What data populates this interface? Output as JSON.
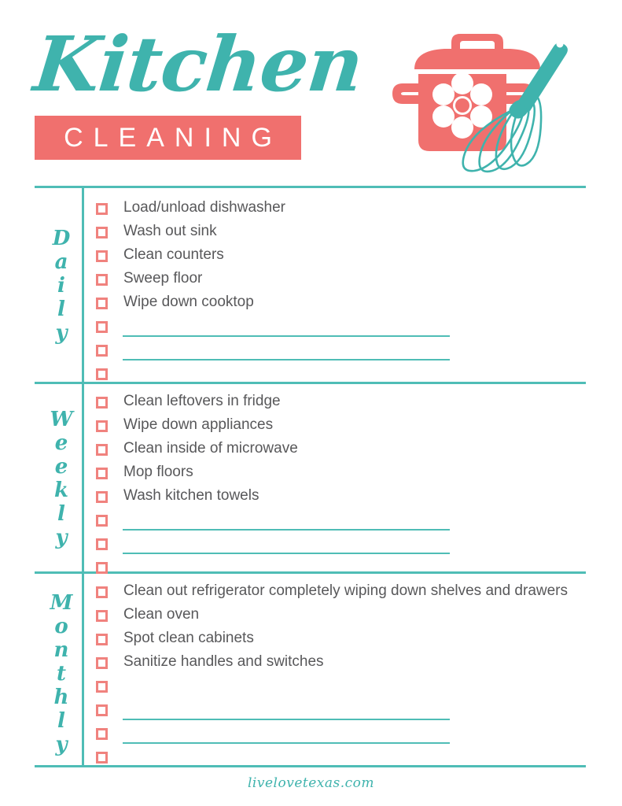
{
  "header": {
    "title_script": "Kitchen",
    "banner_word": "CLEANING",
    "illustration_name": "pot-and-whisk-illustration"
  },
  "colors": {
    "teal": "#3FB3AD",
    "teal_rule": "#4FBDB6",
    "coral": "#F0706E",
    "coral_checkbox": "#F0827E",
    "text_gray": "#58585A",
    "white": "#FFFFFF"
  },
  "sections": [
    {
      "label": "Daily",
      "label_letters": [
        "D",
        "a",
        "i",
        "l",
        "y"
      ],
      "items": [
        "Load/unload dishwasher",
        "Wash out sink",
        "Clean counters",
        "Sweep floor",
        "Wipe down cooktop"
      ],
      "blank_rows": 3,
      "blank_lines": 2
    },
    {
      "label": "Weekly",
      "label_letters": [
        "W",
        "e",
        "e",
        "k",
        "l",
        "y"
      ],
      "items": [
        "Clean leftovers in fridge",
        "Wipe down appliances",
        "Clean inside of microwave",
        "Mop floors",
        "Wash kitchen towels"
      ],
      "blank_rows": 3,
      "blank_lines": 2
    },
    {
      "label": "Monthly",
      "label_letters": [
        "M",
        "o",
        "n",
        "t",
        "h",
        "l",
        "y"
      ],
      "items": [
        "Clean out refrigerator completely wiping down shelves and drawers",
        "Clean oven",
        "Spot clean cabinets",
        "Sanitize handles and switches"
      ],
      "blank_rows": 4,
      "blank_lines": 2
    }
  ],
  "footer": {
    "site": "livelovetexas.com"
  }
}
